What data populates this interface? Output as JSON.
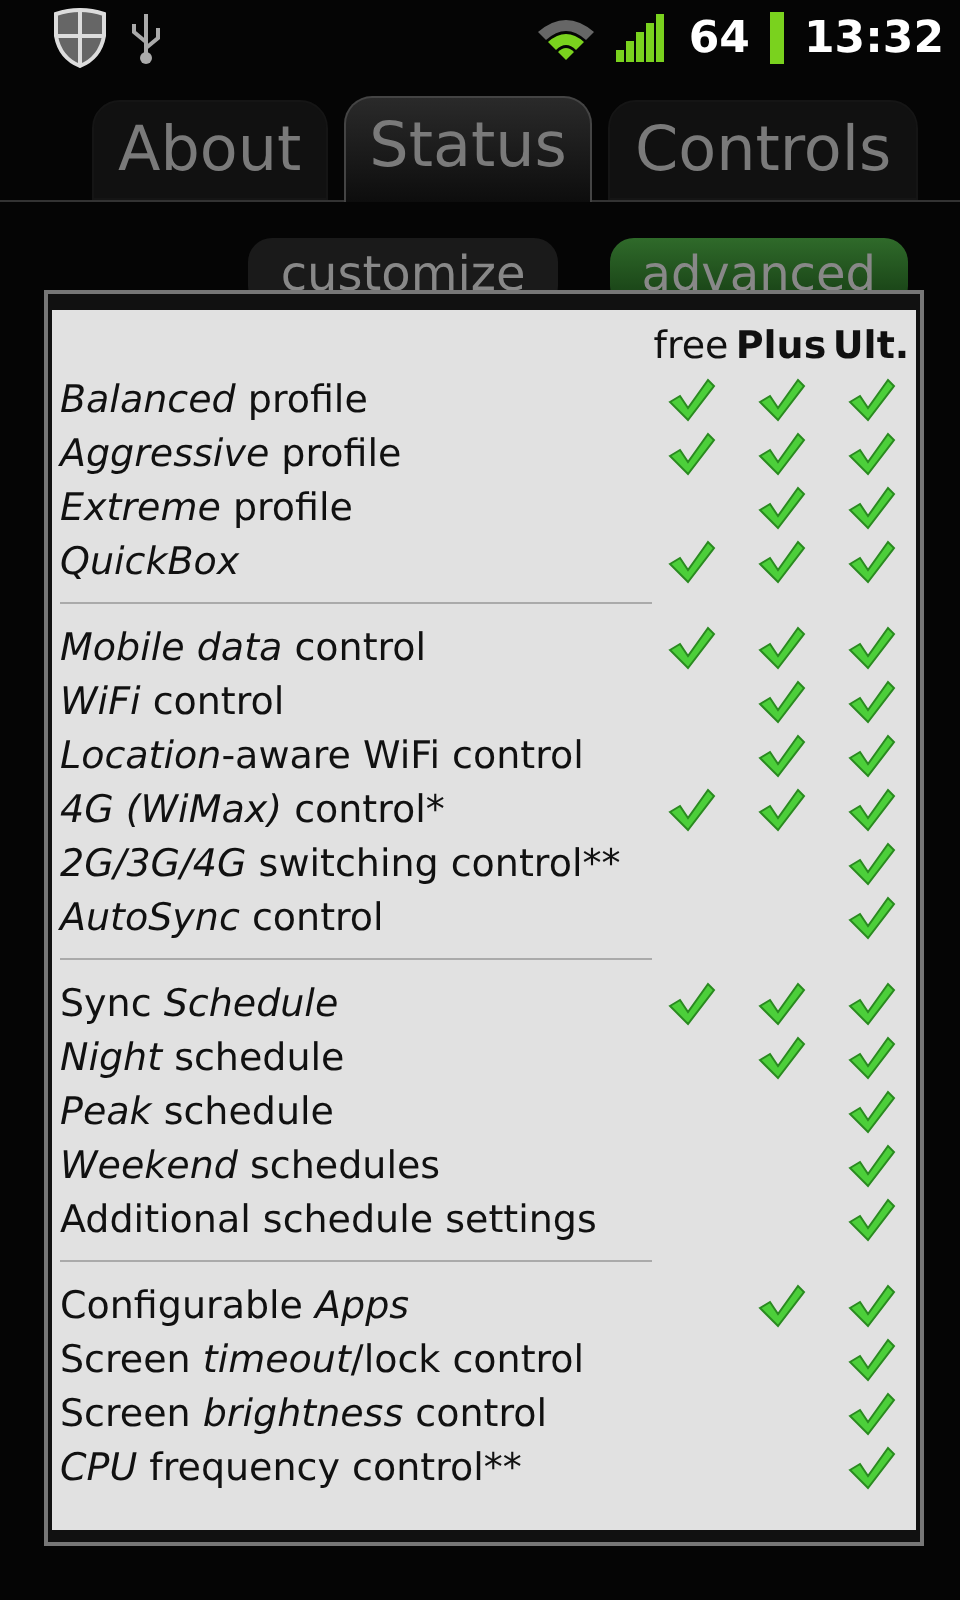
{
  "status_bar": {
    "battery": "64",
    "time": "13:32"
  },
  "tabs": [
    {
      "label": "About",
      "selected": false
    },
    {
      "label": "Status",
      "selected": true
    },
    {
      "label": "Controls",
      "selected": false
    }
  ],
  "mode_buttons": [
    {
      "label": "customize",
      "selected": false
    },
    {
      "label": "advanced",
      "selected": true
    }
  ],
  "dialog": {
    "columns": [
      {
        "label": "free",
        "bold": false
      },
      {
        "label": "Plus",
        "bold": true
      },
      {
        "label": "Ult.",
        "bold": true
      }
    ],
    "groups": [
      {
        "rows": [
          {
            "label": "*Balanced* profile",
            "checks": [
              true,
              true,
              true
            ]
          },
          {
            "label": "*Aggressive* profile",
            "checks": [
              true,
              true,
              true
            ]
          },
          {
            "label": "*Extreme* profile",
            "checks": [
              false,
              true,
              true
            ]
          },
          {
            "label": "*QuickBox*",
            "checks": [
              true,
              true,
              true
            ]
          }
        ]
      },
      {
        "rows": [
          {
            "label": "*Mobile data* control",
            "checks": [
              true,
              true,
              true
            ]
          },
          {
            "label": "*WiFi* control",
            "checks": [
              false,
              true,
              true
            ]
          },
          {
            "label": "*Location*-aware WiFi control",
            "checks": [
              false,
              true,
              true
            ]
          },
          {
            "label": "*4G (WiMax)* control*",
            "checks": [
              true,
              true,
              true
            ]
          },
          {
            "label": "*2G/3G/4G* switching control**",
            "checks": [
              false,
              false,
              true
            ]
          },
          {
            "label": "*AutoSync* control",
            "checks": [
              false,
              false,
              true
            ]
          }
        ]
      },
      {
        "rows": [
          {
            "label": "Sync *Schedule*",
            "checks": [
              true,
              true,
              true
            ]
          },
          {
            "label": "*Night* schedule",
            "checks": [
              false,
              true,
              true
            ]
          },
          {
            "label": "*Peak* schedule",
            "checks": [
              false,
              false,
              true
            ]
          },
          {
            "label": "*Weekend* schedules",
            "checks": [
              false,
              false,
              true
            ]
          },
          {
            "label": "Additional schedule settings",
            "checks": [
              false,
              false,
              true
            ]
          }
        ]
      },
      {
        "rows": [
          {
            "label": "Configurable *Apps*",
            "checks": [
              false,
              true,
              true
            ]
          },
          {
            "label": "Screen *timeout*/lock control",
            "checks": [
              false,
              false,
              true
            ]
          },
          {
            "label": "Screen *brightness* control",
            "checks": [
              false,
              false,
              true
            ]
          },
          {
            "label": "*CPU* frequency control**",
            "checks": [
              false,
              false,
              true
            ]
          }
        ]
      }
    ]
  }
}
